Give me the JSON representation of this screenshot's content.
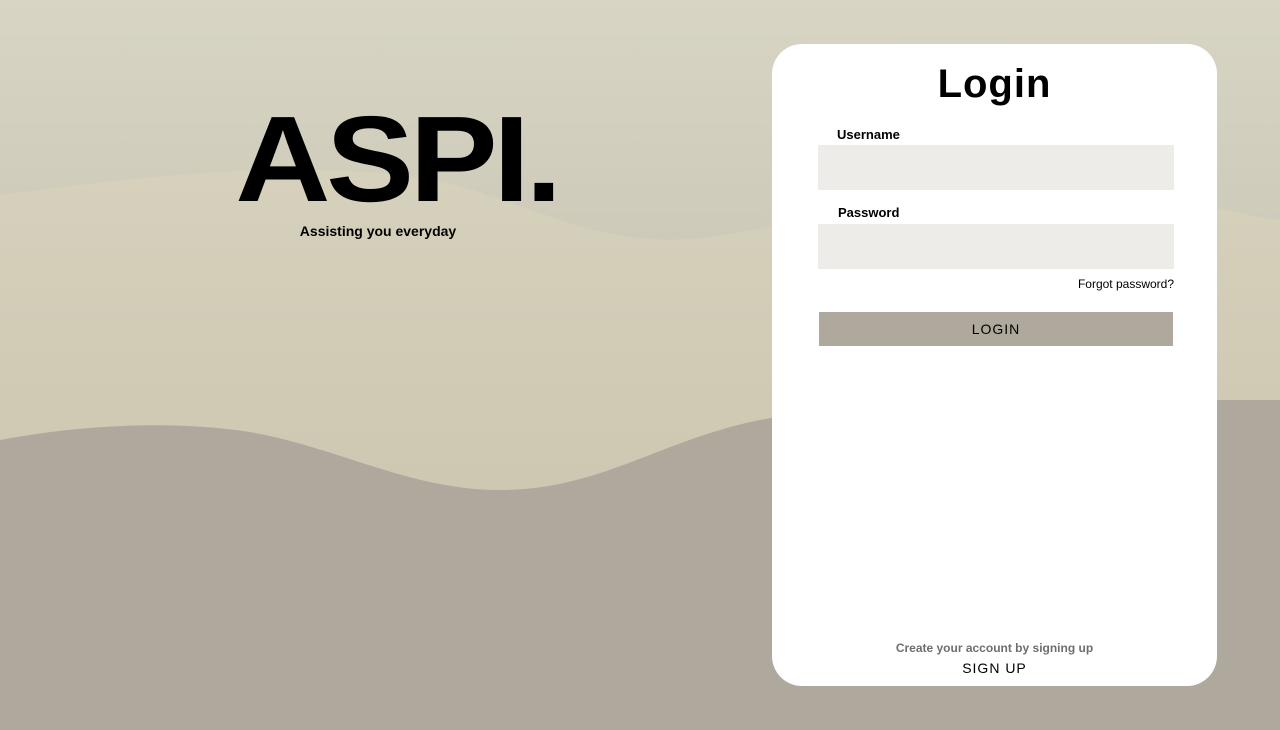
{
  "brand": {
    "logo": "ASPI.",
    "tagline": "Assisting you everyday"
  },
  "login_form": {
    "title": "Login",
    "username_label": "Username",
    "username_value": "",
    "password_label": "Password",
    "password_value": "",
    "forgot_password": "Forgot password?",
    "login_button": "LOGIN",
    "signup_hint": "Create your account by signing up",
    "signup_button": "SIGN UP"
  },
  "colors": {
    "background_light": "#d7d4c3",
    "background_mid": "#cdc5b0",
    "background_dark": "#afa89d",
    "card": "#ffffff",
    "input_fill": "#edece8",
    "button_fill": "#afa89d"
  }
}
